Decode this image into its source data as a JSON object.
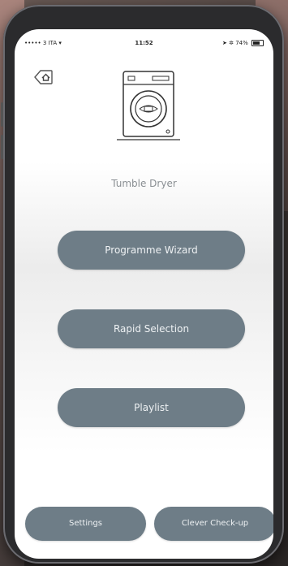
{
  "status_bar": {
    "carrier": "••••• 3 ITA",
    "wifi_icon": "wifi-icon",
    "time": "11:52",
    "bluetooth_icon": "bluetooth-icon",
    "battery_text": "74%"
  },
  "header": {
    "home_icon": "home-back-icon",
    "appliance_icon": "tumble-dryer-icon",
    "device_name": "Tumble Dryer"
  },
  "menu": {
    "programme_wizard": "Programme Wizard",
    "rapid_selection": "Rapid Selection",
    "playlist": "Playlist"
  },
  "footer": {
    "settings": "Settings",
    "clever_checkup": "Clever Check-up"
  },
  "colors": {
    "button_bg": "#6e7d87",
    "button_text": "#eef1f3",
    "label_text": "#8a8f93"
  }
}
